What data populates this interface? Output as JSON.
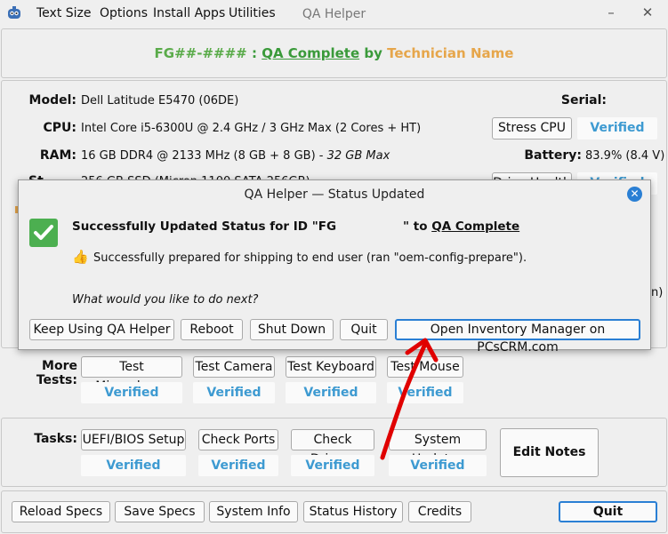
{
  "menu": {
    "items": [
      "Text Size",
      "Options",
      "Install Apps",
      "Utilities"
    ],
    "window_title": "QA Helper",
    "minimize": "–",
    "close": "✕"
  },
  "header": {
    "id": "FG##-####",
    "sep": " : ",
    "status": "QA Complete",
    "by": " by ",
    "technician": "Technician Name",
    "colors": {
      "id": "#5aab4a",
      "status": "#3a9a3a",
      "tech": "#e6a64b"
    }
  },
  "specs": {
    "model_label": "Model:",
    "model_value": "Dell Latitude E5470 (06DE)",
    "serial_label": "Serial:",
    "cpu_label": "CPU:",
    "cpu_value": "Intel Core i5-6300U @ 2.4 GHz / 3 GHz Max (2 Cores + HT)",
    "stress_cpu": "Stress CPU",
    "cpu_verified": "Verified",
    "ram_label": "RAM:",
    "ram_value": "16 GB DDR4 @ 2133 MHz (8 GB + 8 GB) - ",
    "ram_max": "32 GB Max",
    "battery_label": "Battery:",
    "battery_value": "83.9% (8.4 V)",
    "partial_storage_label": "St",
    "partial_storage_value": "256 GB SSD (Micron 1100 SATA 256GB)",
    "partial_drive_btn": "Drive Health",
    "partial_verified": "Verified",
    "partial_right": "n)"
  },
  "more_tests": {
    "label": "More Tests:",
    "buttons": [
      "Test Microphone",
      "Test Camera",
      "Test Keyboard",
      "Test Mouse"
    ],
    "verified": [
      "Verified",
      "Verified",
      "Verified",
      "Verified"
    ]
  },
  "tasks": {
    "label": "Tasks:",
    "buttons": [
      "UEFI/BIOS Setup",
      "Check Ports",
      "Check Drivers",
      "System Updates"
    ],
    "verified": [
      "Verified",
      "Verified",
      "Verified",
      "Verified"
    ],
    "edit_notes": "Edit Notes"
  },
  "bottom": {
    "buttons": [
      "Reload Specs",
      "Save Specs",
      "System Info",
      "Status History",
      "Credits"
    ],
    "quit": "Quit"
  },
  "dialog": {
    "title": "QA Helper  —  Status Updated",
    "close": "✕",
    "heading_prefix": "Successfully Updated Status for ID \"FG",
    "heading_mid": "\" to ",
    "heading_status": "QA Complete",
    "message_icon": "👍",
    "message": "Successfully prepared for shipping to end user (ran \"oem-config-prepare\").",
    "question": "What would you like to do next?",
    "buttons": [
      "Keep Using QA Helper",
      "Reboot",
      "Shut Down",
      "Quit",
      "Open Inventory Manager on PCsCRM.com"
    ]
  },
  "annotation": {
    "color": "#e00000"
  }
}
